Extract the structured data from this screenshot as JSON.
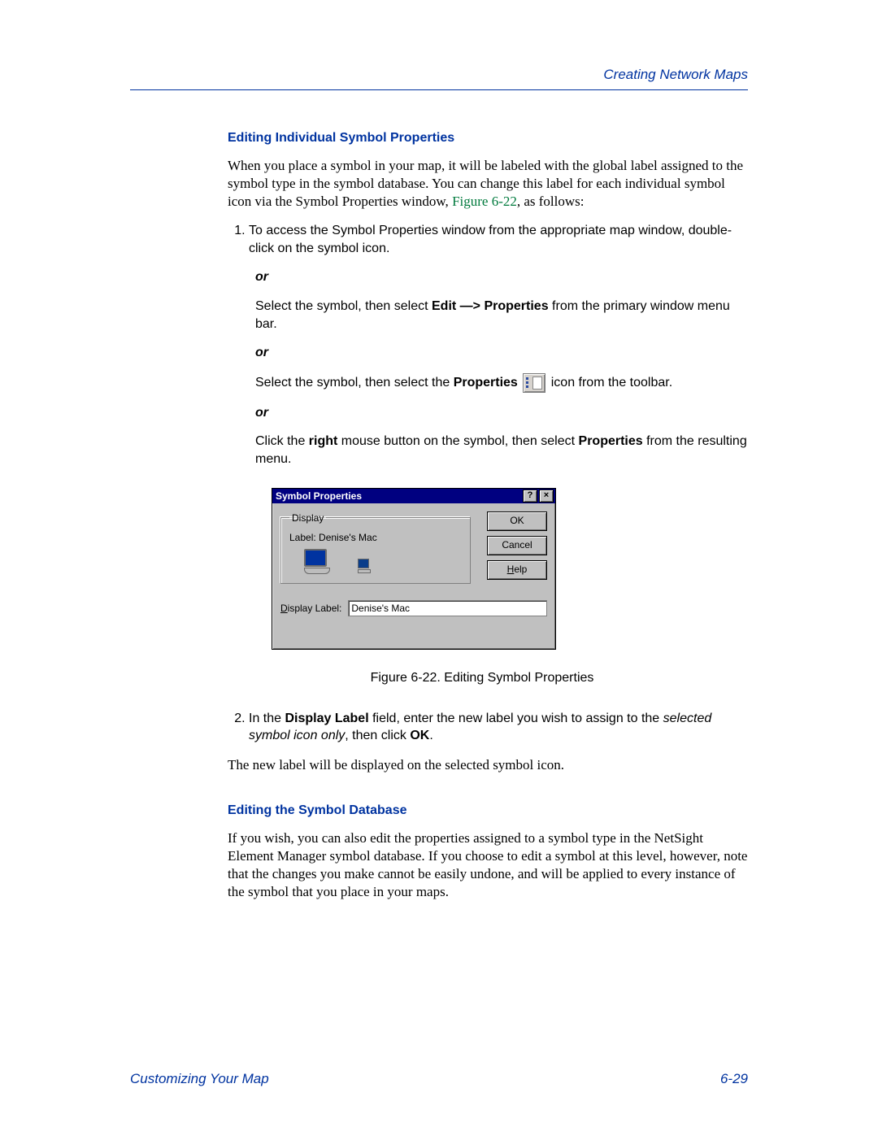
{
  "header": {
    "title": "Creating Network Maps"
  },
  "section1": {
    "heading": "Editing Individual Symbol Properties",
    "intro_part1": "When you place a symbol in your map, it will be labeled with the global label assigned to the symbol type in the symbol database. You can change this label for each individual symbol icon via the Symbol Properties window, ",
    "figref": "Figure 6-22",
    "intro_part2": ", as follows:",
    "step1": "To access the Symbol Properties window from the appropriate map window, double-click on the symbol icon.",
    "or": "or",
    "step1b_pre": "Select the symbol, then select ",
    "step1b_bold": "Edit —> Properties",
    "step1b_post": " from the primary window menu bar.",
    "step1c_pre": "Select the symbol, then select the ",
    "step1c_bold": "Properties",
    "step1c_post": " icon from the toolbar.",
    "step1d_pre": "Click the ",
    "step1d_bold1": "right",
    "step1d_mid": " mouse button on the symbol, then select ",
    "step1d_bold2": "Properties",
    "step1d_post": " from the resulting menu."
  },
  "dialog": {
    "title": "Symbol Properties",
    "help_btn": "?",
    "close_btn": "×",
    "group_legend": "Display",
    "label_prefix": "Label:",
    "label_value": "Denise's Mac",
    "ok": "OK",
    "cancel": "Cancel",
    "help": "Help",
    "field_label_char": "D",
    "field_label_rest": "isplay Label:",
    "field_value": "Denise's Mac"
  },
  "figure_caption": "Figure 6-22.  Editing Symbol Properties",
  "step2": {
    "pre": "In the ",
    "bold1": "Display Label",
    "mid": " field, enter the new label you wish to assign to the ",
    "italic": "selected symbol icon only",
    "post1": ", then click ",
    "bold2": "OK",
    "post2": "."
  },
  "after_steps": "The new label will be displayed on the selected symbol icon.",
  "section2": {
    "heading": "Editing the Symbol Database",
    "body": "If you wish, you can also edit the properties assigned to a symbol type in the NetSight Element Manager symbol database. If you choose to edit a symbol at this level, however, note that the changes you make cannot be easily undone, and will be applied to every instance of the symbol that you place in your maps."
  },
  "footer": {
    "left": "Customizing Your Map",
    "right": "6-29"
  }
}
